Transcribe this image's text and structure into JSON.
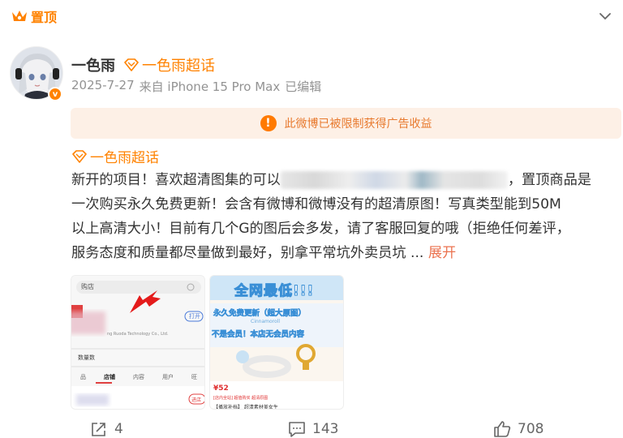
{
  "pinned": {
    "label": "置顶",
    "icon": "crown-icon"
  },
  "post": {
    "author": "一色雨",
    "topic": "一色雨超话",
    "date": "2025-7-27",
    "source": "来自 iPhone 15 Pro Max",
    "edited": "已编辑",
    "notice": "此微博已被限制获得广告收益",
    "text_line1_a": "新开的项目！喜欢超清图集的可以",
    "text_line1_b": "，置顶商品是",
    "text_line2": "一次购买永久免费更新！会含有微博和微博没有的超清原图！写真类型能到50M",
    "text_line3": "以上高清大小！目前有几个G的图后会多发，请了客服回复的哦（拒绝任何差评，",
    "text_line4": "服务态度和质量都尽量做到最好，别拿平常坑外卖员坑",
    "text_ellipsis": " ... ",
    "expand_label": "展开"
  },
  "thumb1": {
    "search_text": "购店",
    "follow_button": "打开",
    "company": "ng Ruoda Technology Co., Ltd.",
    "sales_label": "数量数",
    "tabs": [
      "品",
      "店铺",
      "内容",
      "用户",
      "旺"
    ],
    "bottom_button": "进店"
  },
  "thumb2": {
    "banner_title": "全网最低!!!",
    "line1": "永久免费更新（超大原图）",
    "brand": "Cinnamoroll",
    "line2": "不是会员！本店无会员内容",
    "price": "¥52",
    "tag_text": "[店内全站] 超值购买 超清原图",
    "footer_text": "【播放补档】 超清素材美女生"
  },
  "actions": {
    "repost_count": "4",
    "comment_count": "143",
    "like_count": "708"
  },
  "colors": {
    "accent": "#ff8200",
    "notice_bg": "#fdf0e6",
    "notice_text": "#e87a2f",
    "expand": "#eb7350",
    "meta": "#939393"
  }
}
